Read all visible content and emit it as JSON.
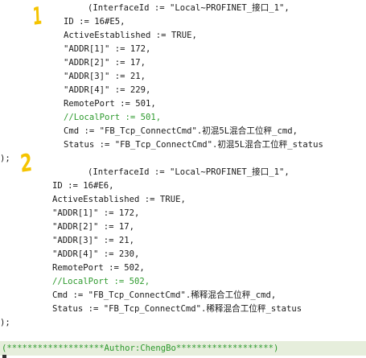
{
  "markers": {
    "first": "1",
    "second": "2"
  },
  "block1": {
    "interface": "(InterfaceId := \"Local~PROFINET_接口_1\",",
    "id": "ID := 16#E5,",
    "active": "ActiveEstablished := TRUE,",
    "addr1": "\"ADDR[1]\" := 172,",
    "addr2": "\"ADDR[2]\" := 17,",
    "addr3": "\"ADDR[3]\" := 21,",
    "addr4": "\"ADDR[4]\" := 229,",
    "remote_port": "RemotePort := 501,",
    "local_port_comment": "//LocalPort := 501,",
    "cmd": "Cmd := \"FB_Tcp_ConnectCmd\".初混5L混合工位秤_cmd,",
    "status": "Status := \"FB_Tcp_ConnectCmd\".初混5L混合工位秤_status",
    "close": ");"
  },
  "block2": {
    "interface": "(InterfaceId := \"Local~PROFINET_接口_1\",",
    "id": "ID := 16#E6,",
    "active": "ActiveEstablished := TRUE,",
    "addr1": "\"ADDR[1]\" := 172,",
    "addr2": "\"ADDR[2]\" := 17,",
    "addr3": "\"ADDR[3]\" := 21,",
    "addr4": "\"ADDR[4]\" := 230,",
    "remote_port": "RemotePort := 502,",
    "local_port_comment": "//LocalPort := 502,",
    "cmd": "Cmd := \"FB_Tcp_ConnectCmd\".稀释混合工位秤_cmd,",
    "status": "Status := \"FB_Tcp_ConnectCmd\".稀释混合工位秤_status",
    "close": ");"
  },
  "footer_comment": "(*******************Author:ChengBo*******************)",
  "colors": {
    "comment": "#2e9a2e",
    "marker": "#f5c400",
    "text": "#1a1a1a",
    "comment_line_bg": "#e6eedc"
  }
}
